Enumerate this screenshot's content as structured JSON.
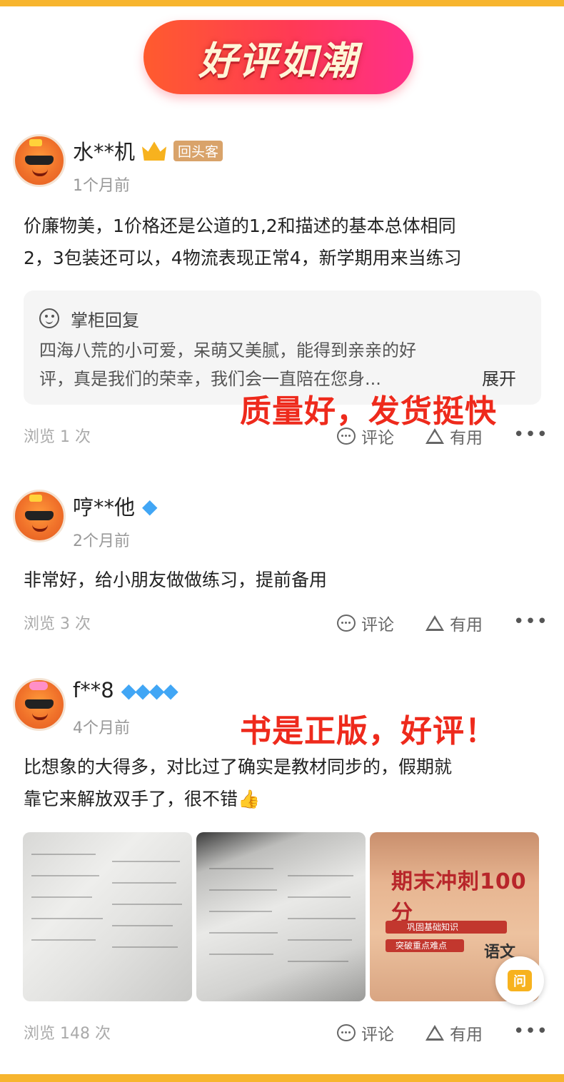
{
  "banner": {
    "title": "好评如潮"
  },
  "reviews": [
    {
      "username": "水**机",
      "badge": "回头客",
      "time": "1个月前",
      "content_lines": [
        "价廉物美，1价格还是公道的1,2和描述的基本总体相同",
        "2，3包装还可以，4物流表现正常4，新学期用来当练习"
      ],
      "reply": {
        "title": "掌柜回复",
        "text_lines": [
          "四海八荒的小可爱，呆萌又美腻，能得到亲亲的好",
          "评，真是我们的荣幸，我们会一直陪在您身..."
        ],
        "expand": "展开"
      },
      "views": "浏览 1 次"
    },
    {
      "username": "哼**他",
      "diamonds": "◆",
      "time": "2个月前",
      "content_lines": [
        "非常好，给小朋友做做练习，提前备用"
      ],
      "views": "浏览 3 次"
    },
    {
      "username": "f**8",
      "diamonds": "◆◆◆◆",
      "time": "4个月前",
      "content_lines": [
        "比想象的大得多，对比过了确实是教材同步的，假期就",
        "靠它来解放双手了，很不错👍"
      ],
      "photos": {
        "cover_title": "期末冲刺100分",
        "cover_strip_1": "巩固基础知识",
        "cover_strip_2": "突破重点难点",
        "cover_subject": "语文"
      },
      "views": "浏览 148 次"
    }
  ],
  "actions": {
    "comment": "评论",
    "useful": "有用",
    "more": "•••"
  },
  "overlays": {
    "first": "质量好，发货挺快",
    "second": "书是正版，好评！"
  },
  "ask_button": "问",
  "colors": {
    "accent": "#f7b52e",
    "overlay_red": "#ee2a1c",
    "diamond_blue": "#41a6f5"
  },
  "icons": [
    "crown-icon",
    "diamond-icon",
    "comment-icon",
    "useful-icon",
    "more-icon",
    "shopkeeper-icon",
    "ask-icon",
    "thumbs-up-icon"
  ]
}
